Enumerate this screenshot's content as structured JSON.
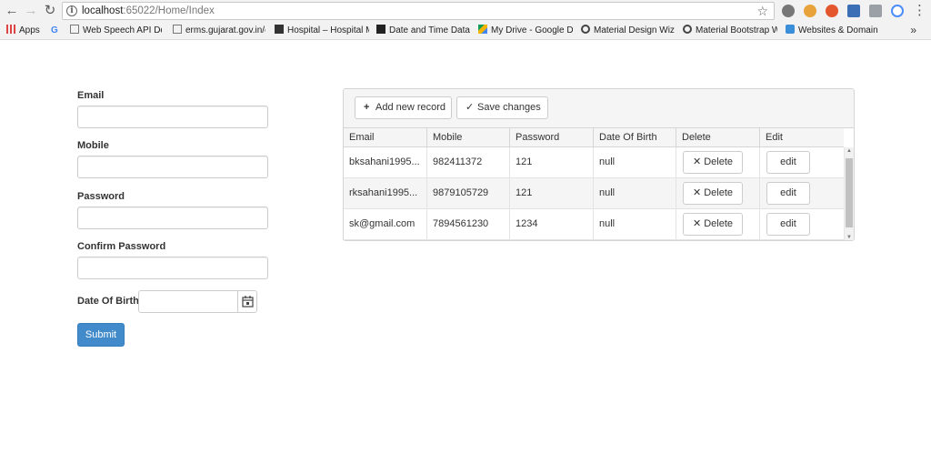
{
  "browser": {
    "url_host": "localhost",
    "url_rest": ":65022/Home/Index",
    "bookmarks": [
      {
        "label": "Apps"
      },
      {
        "label": ""
      },
      {
        "label": "Web Speech API Den"
      },
      {
        "label": "erms.gujarat.gov.in/c"
      },
      {
        "label": "Hospital – Hospital M"
      },
      {
        "label": "Date and Time Data T"
      },
      {
        "label": "My Drive - Google Dr"
      },
      {
        "label": "Material Design Wiza"
      },
      {
        "label": "Material Bootstrap W"
      },
      {
        "label": "Websites & Domains"
      }
    ],
    "more": "»"
  },
  "form": {
    "email_label": "Email",
    "mobile_label": "Mobile",
    "password_label": "Password",
    "confirm_label": "Confirm Password",
    "dob_label": "Date Of Birth",
    "submit_label": "Submit"
  },
  "grid": {
    "add_label": "Add new record",
    "save_label": "Save changes",
    "columns": [
      "Email",
      "Mobile",
      "Password",
      "Date Of Birth",
      "Delete",
      "Edit"
    ],
    "rows": [
      {
        "email": "bksahani1995...",
        "mobile": "982411372",
        "password": "121",
        "dob": "null",
        "delete": "Delete",
        "edit": "edit"
      },
      {
        "email": "rksahani1995...",
        "mobile": "9879105729",
        "password": "121",
        "dob": "null",
        "delete": "Delete",
        "edit": "edit"
      },
      {
        "email": "sk@gmail.com",
        "mobile": "7894561230",
        "password": "1234",
        "dob": "null",
        "delete": "Delete",
        "edit": "edit"
      }
    ]
  },
  "colors": {
    "accent": "#428bca",
    "toolbar_bg": "#f5f5f5"
  }
}
